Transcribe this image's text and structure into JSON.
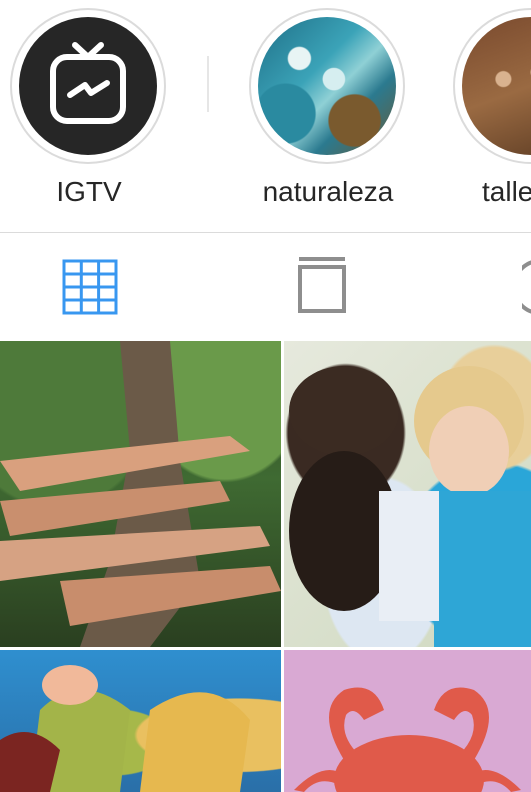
{
  "highlights": [
    {
      "label": "IGTV",
      "icon": "igtv-icon"
    },
    {
      "label": "naturaleza",
      "icon": "photo"
    },
    {
      "label": "talle",
      "icon": "photo"
    }
  ],
  "tabs": [
    {
      "name": "grid",
      "icon": "grid-icon",
      "active": true,
      "color": "#3897f0"
    },
    {
      "name": "igtv",
      "icon": "igtv-tab-icon",
      "active": false,
      "color": "#8e8e8e"
    },
    {
      "name": "tagged",
      "icon": "tagged-icon",
      "active": false,
      "color": "#8e8e8e"
    }
  ],
  "grid_posts": [
    {
      "description": "hands-on-tree-trunk"
    },
    {
      "description": "girls-reading"
    },
    {
      "description": "autumn-leaves-hands"
    },
    {
      "description": "red-crab-graphic"
    }
  ],
  "colors": {
    "active_tab": "#3897f0",
    "inactive_tab": "#8e8e8e",
    "text": "#262626",
    "divider": "#dbdbdb",
    "crab": "#e05a4a",
    "crab_bg": "#d9a9d3"
  }
}
